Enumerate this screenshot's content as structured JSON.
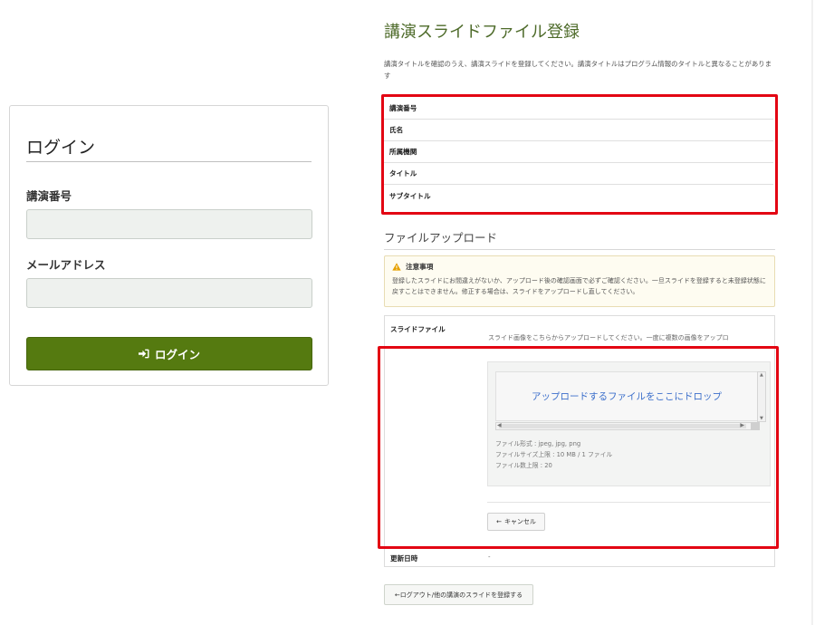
{
  "login": {
    "title": "ログイン",
    "number_label": "講演番号",
    "number_value": "",
    "email_label": "メールアドレス",
    "email_value": "",
    "button_label": "ログイン",
    "button_icon": "sign-in-icon"
  },
  "registration": {
    "title": "講演スライドファイル登録",
    "intro": "講演タイトルを確認のうえ、講演スライドを登録してください。講演タイトルはプログラム情報のタイトルと異なることがあります",
    "info_rows": [
      "講演番号",
      "氏名",
      "所属機関",
      "タイトル",
      "サブタイトル"
    ]
  },
  "upload": {
    "section_title": "ファイルアップロード",
    "notice_title": "注意事項",
    "notice_text": "登録したスライドにお間違えがないか、アップロード後の確認画面で必ずご確認ください。一旦スライドを登録すると未登録状態に戻すことはできません。修正する場合は、スライドをアップロードし直してください。",
    "slide_file_label": "スライドファイル",
    "slide_file_desc": "スライド画像をこちらからアップロードしてください。一度に複数の画像をアップロ",
    "dropzone_text": "アップロードするファイルをここにドロップ",
    "file_formats": "ファイル形式 : jpeg, jpg, png",
    "file_size_limit": "ファイルサイズ上限 : 10 MB / 1 ファイル",
    "file_count_limit": "ファイル数上限 : 20",
    "cancel_label": "キャンセル",
    "updated_label": "更新日時",
    "updated_value": "-"
  },
  "logout_label": "←ログアウト/他の講演のスライドを登録する",
  "colors": {
    "accent_green": "#557a10",
    "title_green": "#4e6b2a",
    "highlight_red": "#e30613",
    "link_blue": "#3c6fcb"
  }
}
